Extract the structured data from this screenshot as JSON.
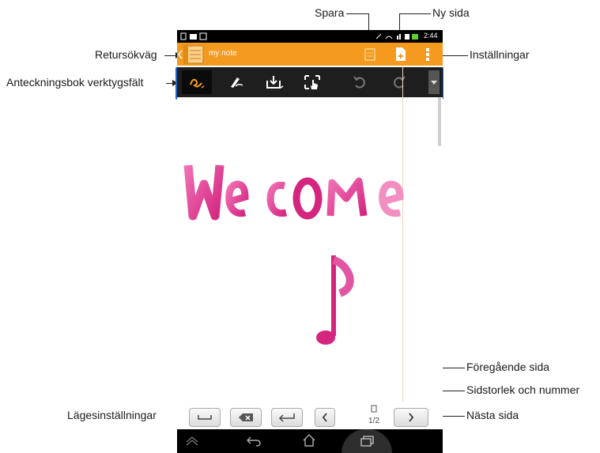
{
  "status_bar": {
    "time": "2:44"
  },
  "action_bar": {
    "title": "my note"
  },
  "page_indicator": {
    "text": "1/2"
  },
  "canvas": {
    "handwriting_text": "Welcome",
    "brand_color": "#e83e9a"
  },
  "colors": {
    "action_bar": "#f39a1f",
    "toolbar": "#1e1e1e",
    "accent": "#f39a1f",
    "callout_box": "#1e64c8"
  },
  "callouts": {
    "spara": "Spara",
    "ny_sida": "Ny sida",
    "retursokvag": "Retursökväg",
    "installningar": "Inställningar",
    "anteckningsbok": "Anteckningsbok verktygsfält",
    "foregaende_sida": "Föregående sida",
    "sidstorlek": "Sidstorlek och nummer",
    "lagesinstallningar": "Lägesinställningar",
    "nasta_sida": "Nästa sida"
  },
  "icons": {
    "toolbar": [
      "handwriting-icon",
      "pen-icon",
      "insert-icon",
      "select-icon",
      "undo-icon",
      "redo-icon",
      "overflow-icon"
    ],
    "actions": [
      "save-icon",
      "new-page-icon",
      "menu-icon"
    ],
    "mode": [
      "space-icon",
      "backspace-icon",
      "enter-icon"
    ],
    "nav": [
      "back-icon",
      "home-icon",
      "recent-apps-icon"
    ]
  }
}
